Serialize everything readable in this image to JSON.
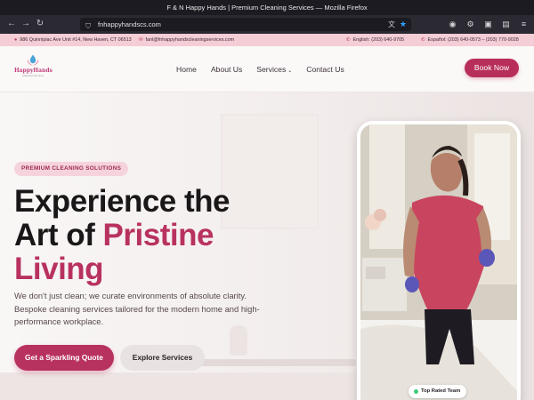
{
  "window": {
    "title": "F & N Happy Hands | Premium Cleaning Services — Mozilla Firefox"
  },
  "browser": {
    "url": "fnhappyhandscs.com"
  },
  "topbar": {
    "address": "986 Quinnipiac Ave Unit #14, New Haven, CT 06513",
    "email": "fanl@fnhappyhandscleaningservices.com",
    "phone_english": "English: (203) 640-9705",
    "phone_spanish": "Español: (203) 640-0573 – (203) 770-9028"
  },
  "header": {
    "logo_text": "HappyHands",
    "logo_sub": "Cleaning Services",
    "menu": [
      "Home",
      "About Us",
      "Services",
      "Contact Us"
    ],
    "book_label": "Book Now"
  },
  "hero": {
    "badge": "PREMIUM CLEANING SOLUTIONS",
    "headline_1": "Experience the",
    "headline_2": "Art of ",
    "headline_accent_1": "Pristine",
    "headline_accent_2": "Living",
    "description": "We don't just clean; we curate environments of absolute clarity. Bespoke cleaning services tailored for the modern home and high-performance workplace.",
    "primary_cta": "Get a Sparkling Quote",
    "secondary_cta": "Explore Services",
    "rated_label": "Top Rated Team"
  },
  "colors": {
    "accent": "#b8325f",
    "topbar": "#f4cdd6",
    "badge_bg": "#f6d3dc"
  }
}
